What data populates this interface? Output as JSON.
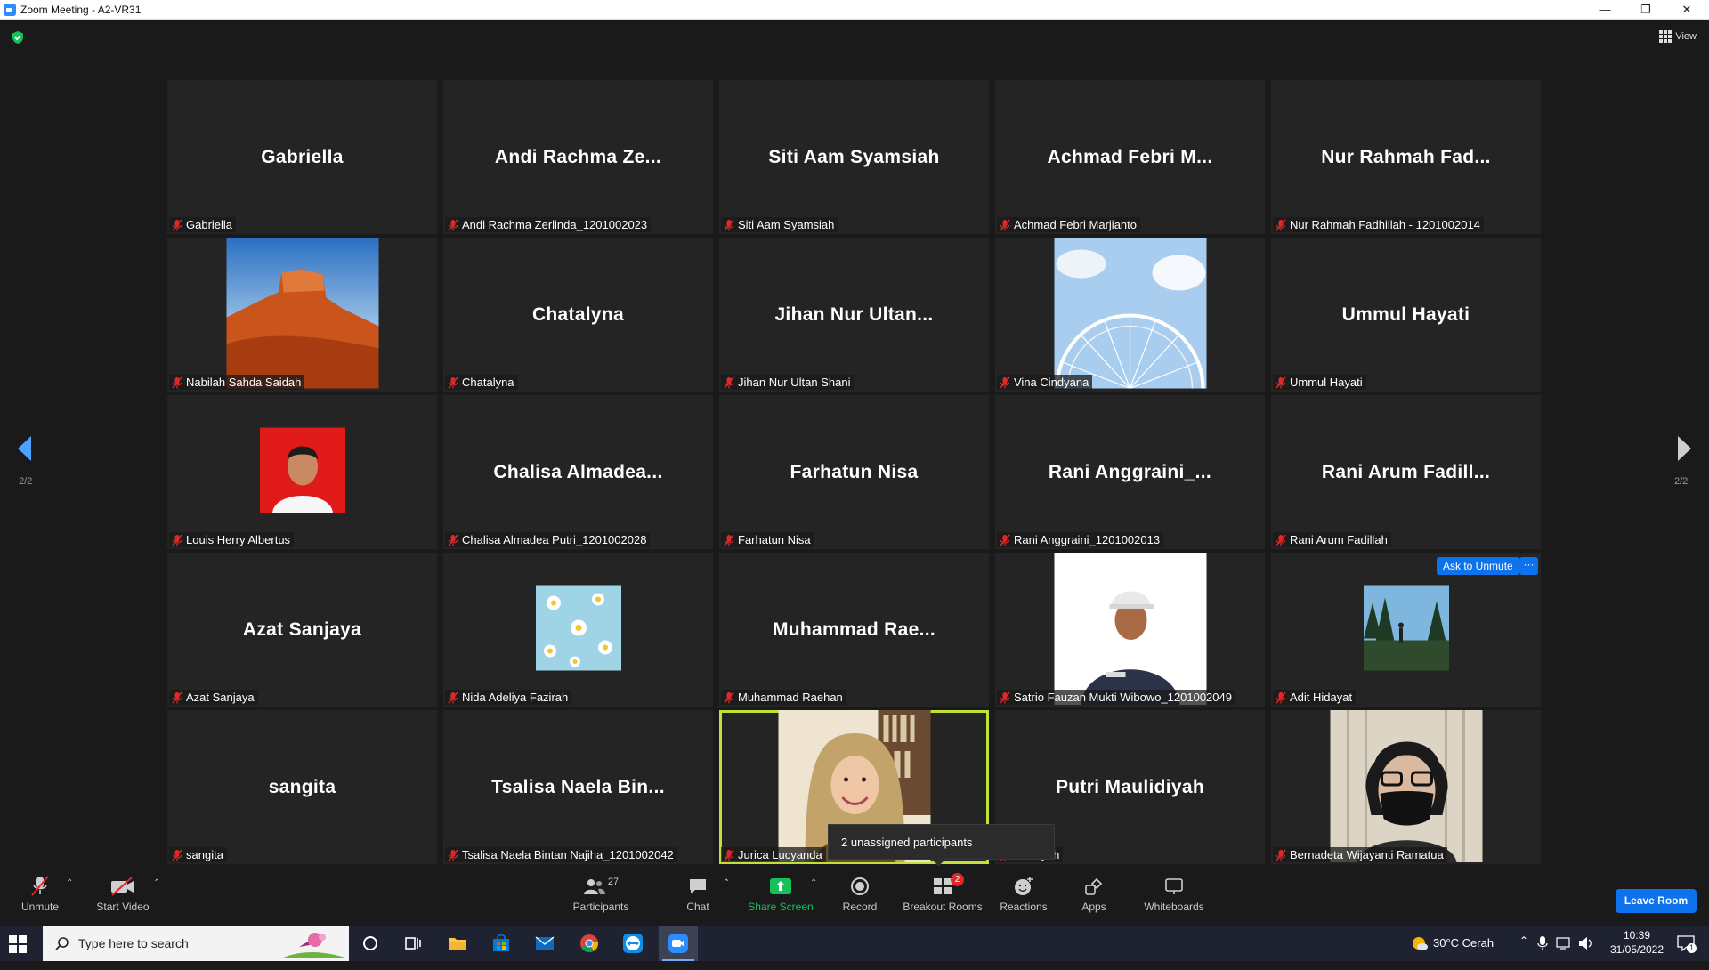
{
  "window": {
    "title": "Zoom Meeting - A2-VR31",
    "minimize": "—",
    "maximize": "❐",
    "close": "✕"
  },
  "view": {
    "label": "View"
  },
  "pagination": {
    "prev_page": "2/2",
    "next_page": "2/2"
  },
  "tiles": [
    {
      "big": "Gabriella",
      "label": "Gabriella"
    },
    {
      "big": "Andi Rachma Ze...",
      "label": "Andi Rachma Zerlinda_1201002023"
    },
    {
      "big": "Siti Aam Syamsiah",
      "label": "Siti Aam Syamsiah"
    },
    {
      "big": "Achmad Febri M...",
      "label": "Achmad Febri Marjianto"
    },
    {
      "big": "Nur Rahmah Fad...",
      "label": "Nur Rahmah Fadhillah - 1201002014"
    },
    {
      "big": "",
      "label": "Nabilah Sahda Saidah",
      "photo": "desert"
    },
    {
      "big": "Chatalyna",
      "label": "Chatalyna"
    },
    {
      "big": "Jihan Nur Ultan...",
      "label": "Jihan Nur Ultan Shani"
    },
    {
      "big": "",
      "label": "Vina Cindyana",
      "photo": "ferris-wheel"
    },
    {
      "big": "Ummul Hayati",
      "label": "Ummul Hayati"
    },
    {
      "big": "",
      "label": "Louis Herry Albertus",
      "photo": "portrait-red"
    },
    {
      "big": "Chalisa Almadea...",
      "label": "Chalisa Almadea Putri_1201002028"
    },
    {
      "big": "Farhatun Nisa",
      "label": "Farhatun Nisa"
    },
    {
      "big": "Rani Anggraini_...",
      "label": "Rani Anggraini_1201002013"
    },
    {
      "big": "Rani Arum Fadill...",
      "label": "Rani Arum Fadillah"
    },
    {
      "big": "Azat Sanjaya",
      "label": "Azat Sanjaya"
    },
    {
      "big": "",
      "label": "Nida Adeliya Fazirah",
      "photo": "daisies"
    },
    {
      "big": "Muhammad Rae...",
      "label": "Muhammad Raehan"
    },
    {
      "big": "",
      "label": "Satrio Fauzan Mukti Wibowo_1201002049",
      "photo": "man-white"
    },
    {
      "big": "",
      "label": "Adit Hidayat",
      "photo": "forest"
    },
    {
      "big": "sangita",
      "label": "sangita"
    },
    {
      "big": "Tsalisa Naela Bin...",
      "label": "Tsalisa Naela Bintan Najiha_1201002042"
    },
    {
      "big": "",
      "label": "Jurica Lucyanda",
      "photo": "woman-hijab",
      "active": true
    },
    {
      "big": "Putri Maulidiyah",
      "label": "aulidiyah"
    },
    {
      "big": "",
      "label": "Bernadeta Wijayanti Ramatua",
      "photo": "masked-person"
    }
  ],
  "ask_to_unmute": "Ask to Unmute",
  "ask_more": "···",
  "tooltip": "2 unassigned participants",
  "toolbar": {
    "unmute": "Unmute",
    "start_video": "Start Video",
    "participants": "Participants",
    "participants_count": "27",
    "chat": "Chat",
    "share_screen": "Share Screen",
    "record": "Record",
    "breakout_rooms": "Breakout Rooms",
    "breakout_badge": "2",
    "reactions": "Reactions",
    "apps": "Apps",
    "whiteboards": "Whiteboards",
    "leave": "Leave Room"
  },
  "taskbar": {
    "search_placeholder": "Type here to search",
    "weather": "30°C  Cerah",
    "time": "10:39",
    "date": "31/05/2022",
    "notification_count": "1"
  },
  "colors": {
    "accent_blue": "#0e72ed",
    "active_speaker": "#bfe23a",
    "muted_red": "#e02828",
    "share_green": "#16c05b"
  }
}
